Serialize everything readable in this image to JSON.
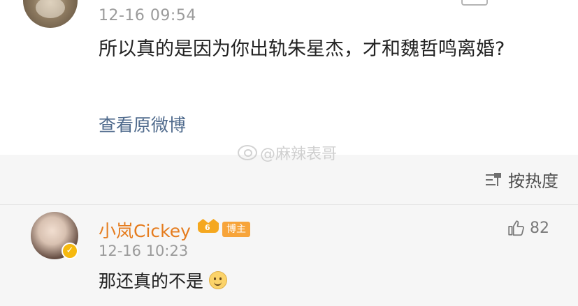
{
  "post": {
    "time": "12-16 09:54",
    "text": "所以真的是因为你出轨朱星杰，才和魏哲鸣离婚?",
    "view_original": "查看原微博"
  },
  "watermark": {
    "text": "@麻辣表哥"
  },
  "sort": {
    "label": "按热度"
  },
  "comment": {
    "username": "小岚Cickey",
    "vip_level": "6",
    "badge": "博主",
    "time": "12-16 10:23",
    "text": "那还真的不是",
    "likes": "82"
  },
  "colors": {
    "username": "#e57c1e",
    "link": "#506b8d"
  }
}
